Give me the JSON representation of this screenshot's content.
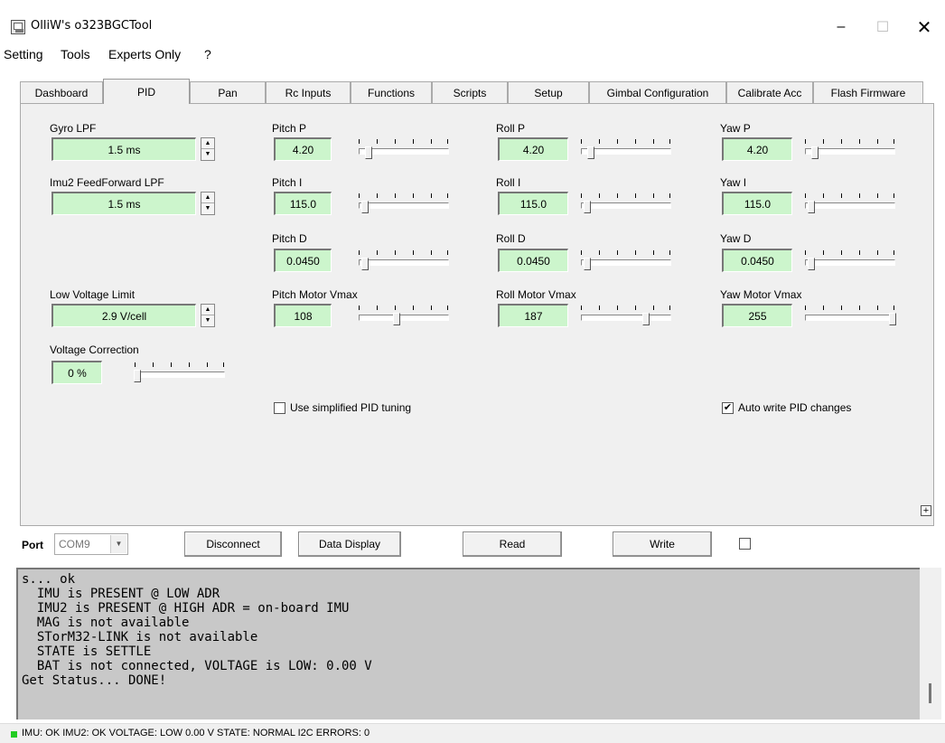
{
  "window": {
    "title": "OlliW's o323BGCTool",
    "minimize": "–",
    "maximize": "☐",
    "close": "✕"
  },
  "menu": [
    "Setting",
    "Tools",
    "Experts Only",
    "?"
  ],
  "tabs": [
    {
      "label": "Dashboard",
      "active": false
    },
    {
      "label": "PID",
      "active": true
    },
    {
      "label": "Pan",
      "active": false
    },
    {
      "label": "Rc Inputs",
      "active": false
    },
    {
      "label": "Functions",
      "active": false
    },
    {
      "label": "Scripts",
      "active": false
    },
    {
      "label": "Setup",
      "active": false
    },
    {
      "label": "Gimbal Configuration",
      "active": false
    },
    {
      "label": "Calibrate Acc",
      "active": false
    },
    {
      "label": "Flash Firmware",
      "active": false
    }
  ],
  "pid": {
    "gyro_lpf": {
      "label": "Gyro LPF",
      "value": "1.5 ms"
    },
    "imu2_ff_lpf": {
      "label": "Imu2 FeedForward LPF",
      "value": "1.5 ms"
    },
    "low_voltage": {
      "label": "Low Voltage Limit",
      "value": "2.9 V/cell"
    },
    "voltage_correction": {
      "label": "Voltage Correction",
      "value": "0 %",
      "slider_fraction": 0.0
    },
    "pitch_p": {
      "label": "Pitch P",
      "value": "4.20",
      "slider_fraction": 0.08
    },
    "pitch_i": {
      "label": "Pitch I",
      "value": "115.0",
      "slider_fraction": 0.04
    },
    "pitch_d": {
      "label": "Pitch D",
      "value": "0.0450",
      "slider_fraction": 0.04
    },
    "pitch_vmax": {
      "label": "Pitch Motor Vmax",
      "value": "108",
      "slider_fraction": 0.42
    },
    "roll_p": {
      "label": "Roll P",
      "value": "4.20",
      "slider_fraction": 0.08
    },
    "roll_i": {
      "label": "Roll I",
      "value": "115.0",
      "slider_fraction": 0.04
    },
    "roll_d": {
      "label": "Roll D",
      "value": "0.0450",
      "slider_fraction": 0.04
    },
    "roll_vmax": {
      "label": "Roll Motor Vmax",
      "value": "187",
      "slider_fraction": 0.73
    },
    "yaw_p": {
      "label": "Yaw P",
      "value": "4.20",
      "slider_fraction": 0.08
    },
    "yaw_i": {
      "label": "Yaw I",
      "value": "115.0",
      "slider_fraction": 0.04
    },
    "yaw_d": {
      "label": "Yaw D",
      "value": "0.0450",
      "slider_fraction": 0.04
    },
    "yaw_vmax": {
      "label": "Yaw Motor Vmax",
      "value": "255",
      "slider_fraction": 1.0
    },
    "simplified": {
      "label": "Use simplified PID tuning",
      "checked": false
    },
    "auto_write": {
      "label": "Auto write PID changes",
      "checked": true
    }
  },
  "port": {
    "label": "Port",
    "value": "COM9",
    "disconnect": "Disconnect",
    "data_display": "Data Display",
    "read": "Read",
    "write": "Write"
  },
  "log": "s... ok\n  IMU is PRESENT @ LOW ADR\n  IMU2 is PRESENT @ HIGH ADR = on-board IMU\n  MAG is not available\n  STorM32-LINK is not available\n  STATE is SETTLE\n  BAT is not connected, VOLTAGE is LOW: 0.00 V\nGet Status... DONE!",
  "status": "IMU: OK   IMU2: OK   VOLTAGE: LOW 0.00 V   STATE: NORMAL   I2C ERRORS: 0",
  "colors": {
    "field_green": "#ccf5cc",
    "log_bg": "#c8c8c8",
    "led_green": "#22cc22"
  }
}
